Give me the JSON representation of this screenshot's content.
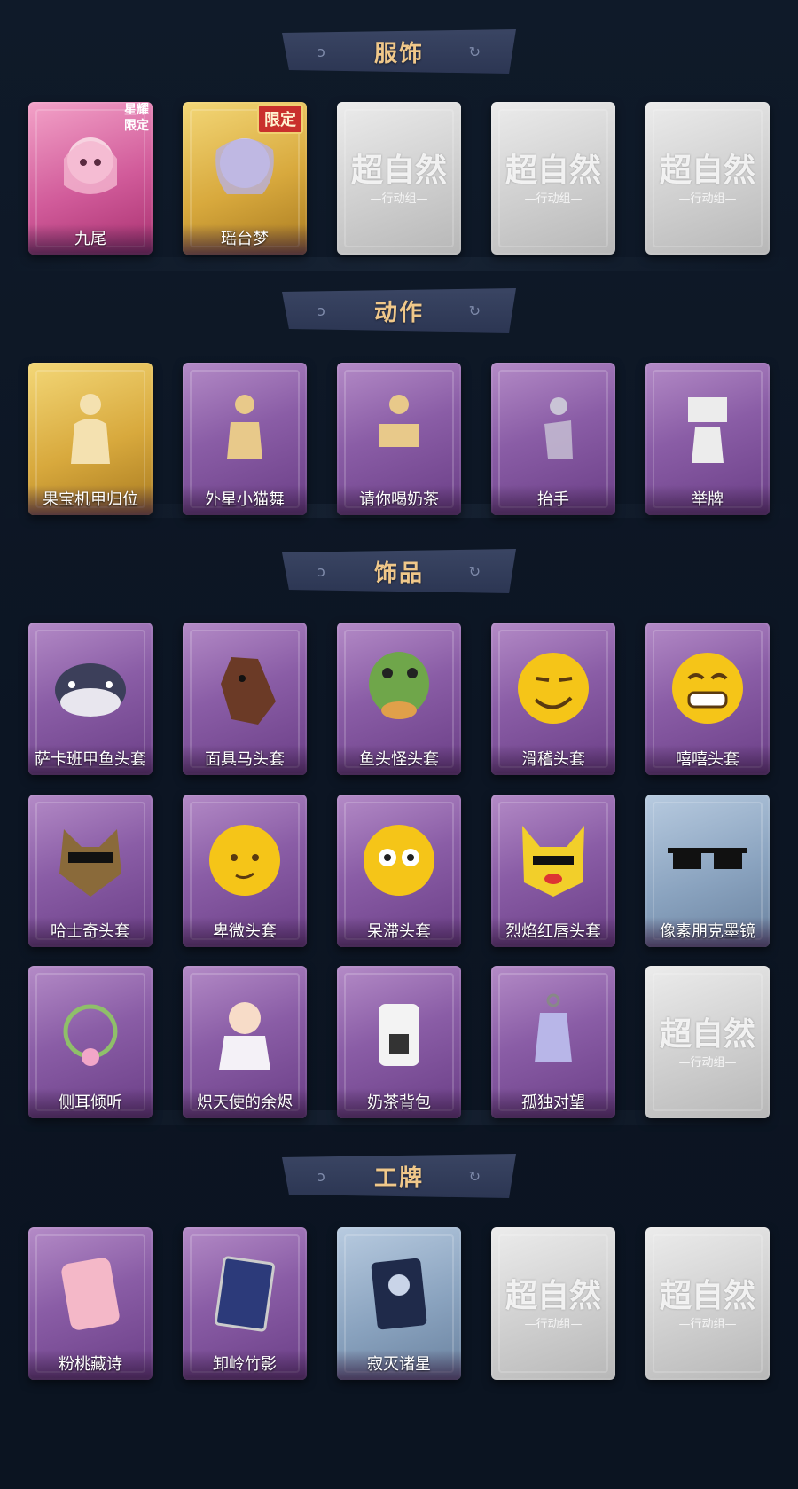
{
  "watermark": {
    "main": "超自然",
    "sub": "—行动组—"
  },
  "sections": [
    {
      "title": "服饰",
      "items": [
        {
          "label": "九尾",
          "badge": "星耀限定"
        },
        {
          "label": "瑶台梦",
          "badge": "限定"
        },
        {
          "label": ""
        },
        {
          "label": ""
        },
        {
          "label": ""
        }
      ]
    },
    {
      "title": "动作",
      "items": [
        {
          "label": "果宝机甲归位"
        },
        {
          "label": "外星小猫舞"
        },
        {
          "label": "请你喝奶茶"
        },
        {
          "label": "抬手"
        },
        {
          "label": "举牌"
        }
      ]
    },
    {
      "title": "饰品",
      "items": [
        {
          "label": "萨卡班甲鱼头套"
        },
        {
          "label": "面具马头套"
        },
        {
          "label": "鱼头怪头套"
        },
        {
          "label": "滑稽头套"
        },
        {
          "label": "嘻嘻头套"
        },
        {
          "label": "哈士奇头套"
        },
        {
          "label": "卑微头套"
        },
        {
          "label": "呆滞头套"
        },
        {
          "label": "烈焰红唇头套"
        },
        {
          "label": "像素朋克墨镜"
        },
        {
          "label": "侧耳倾听"
        },
        {
          "label": "炽天使的余烬"
        },
        {
          "label": "奶茶背包"
        },
        {
          "label": "孤独对望"
        },
        {
          "label": ""
        }
      ]
    },
    {
      "title": "工牌",
      "items": [
        {
          "label": "粉桃藏诗"
        },
        {
          "label": "卸岭竹影"
        },
        {
          "label": "寂灭诸星"
        },
        {
          "label": ""
        },
        {
          "label": ""
        }
      ]
    }
  ]
}
